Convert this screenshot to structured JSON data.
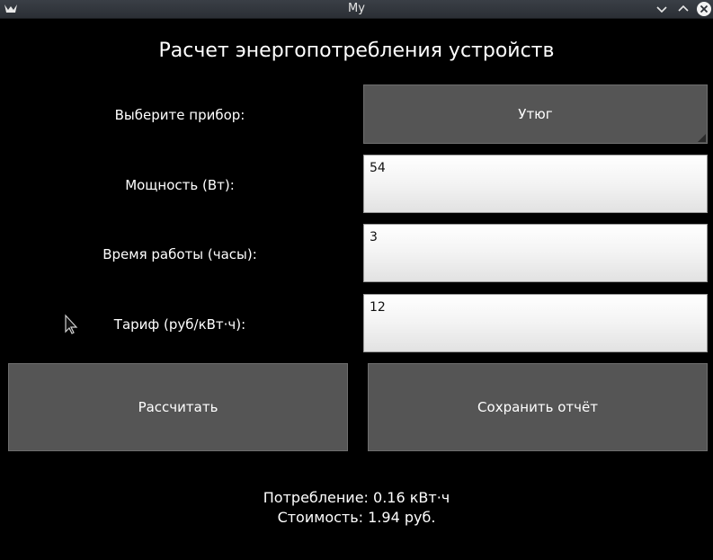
{
  "window": {
    "title": "My"
  },
  "form": {
    "heading": "Расчет энергопотребления устройств",
    "device_label": "Выберите прибор:",
    "device_selected": "Утюг",
    "power_label": "Мощность (Вт):",
    "power_value": "54",
    "hours_label": "Время работы (часы):",
    "hours_value": "3",
    "tariff_label": "Тариф (руб/кВт·ч):",
    "tariff_value": "12"
  },
  "actions": {
    "calculate_label": "Рассчитать",
    "save_label": "Сохранить отчёт"
  },
  "results": {
    "consumption": "Потребление: 0.16 кВт·ч",
    "cost": "Стоимость: 1.94 руб."
  },
  "colors": {
    "background": "#000000",
    "button": "#555555",
    "text": "#ffffff"
  }
}
